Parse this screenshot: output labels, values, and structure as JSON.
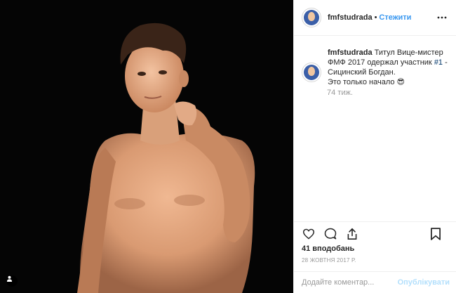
{
  "post": {
    "username": "fmfstudrada",
    "separator": "•",
    "follow_label": "Стежити",
    "caption": {
      "username": "fmfstudrada",
      "text_before": "Титул Вице-мистер ФМФ 2017 одержал участник ",
      "tag": "#1",
      "text_after": " - Сицинский Богдан.",
      "line2": "Это только начало 😎",
      "time": "74 тиж."
    },
    "likes": "41 вподобань",
    "date": "28 ЖОВТНЯ 2017 Р.",
    "comment": {
      "placeholder": "Додайте коментар...",
      "publish_label": "Опублікувати"
    }
  },
  "icons": {
    "like": "heart-icon",
    "comment": "comment-icon",
    "share": "share-icon",
    "save": "bookmark-icon",
    "more": "more-icon",
    "tag": "user-tag-icon"
  },
  "colors": {
    "accent": "#3897f0",
    "link": "#003569",
    "muted": "#999999",
    "publish_disabled": "#b2dffc",
    "border": "#efefef"
  }
}
